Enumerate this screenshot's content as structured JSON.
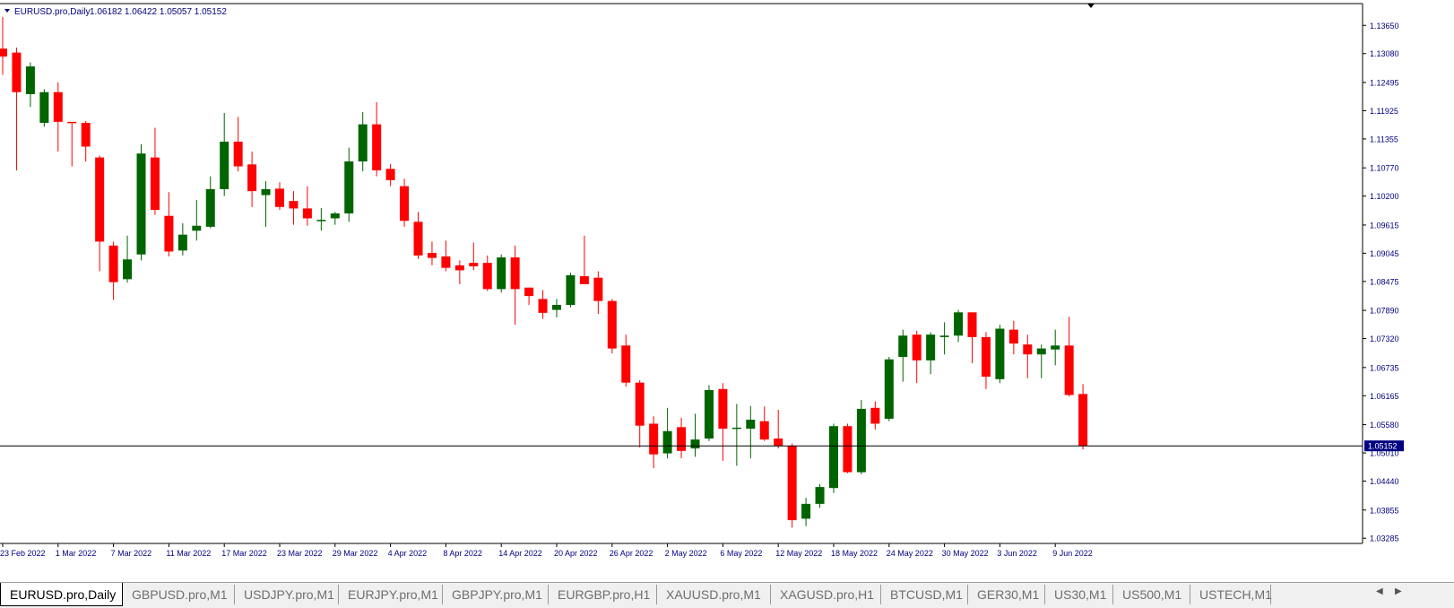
{
  "header": {
    "symbol_label": "EURUSD.pro,Daily",
    "ohlc_label": "1.06182 1.06422 1.05057 1.05152",
    "collapse_icon": "triangle-down-icon"
  },
  "tabs": [
    {
      "label": "EURUSD.pro,Daily",
      "active": true
    },
    {
      "label": "GBPUSD.pro,M1"
    },
    {
      "label": "USDJPY.pro,M1"
    },
    {
      "label": "EURJPY.pro,M1"
    },
    {
      "label": "GBPJPY.pro,M1"
    },
    {
      "label": "EURGBP.pro,H1"
    },
    {
      "label": "XAUUSD.pro,M1"
    },
    {
      "label": "XAGUSD.pro,H1"
    },
    {
      "label": "BTCUSD,M1"
    },
    {
      "label": "GER30,M1"
    },
    {
      "label": "US30,M1"
    },
    {
      "label": "US500,M1"
    },
    {
      "label": "USTECH,M1"
    }
  ],
  "tab_scroll": {
    "left_icon": "arrow-left-icon",
    "right_icon": "arrow-right-icon"
  },
  "chart_data": {
    "type": "candlestick",
    "symbol": "EURUSD.pro",
    "timeframe": "Daily",
    "colors": {
      "up": "#006400",
      "down": "#ff0000",
      "axis": "#000080",
      "price_line": "#000000",
      "price_label_bg": "#000080"
    },
    "y_ticks": [
      1.03285,
      1.03855,
      1.0444,
      1.0501,
      1.0558,
      1.06165,
      1.06735,
      1.0732,
      1.0789,
      1.08475,
      1.09045,
      1.09615,
      1.102,
      1.1077,
      1.11355,
      1.11925,
      1.12495,
      1.1308,
      1.1365
    ],
    "y_tick_labels": [
      "1.03285",
      "1.03855",
      "1.04440",
      "1.05010",
      "1.05580",
      "1.06165",
      "1.06735",
      "1.07320",
      "1.07890",
      "1.08475",
      "1.09045",
      "1.09615",
      "1.10200",
      "1.10770",
      "1.11355",
      "1.11925",
      "1.12495",
      "1.13080",
      "1.13650"
    ],
    "ylim": [
      1.0318,
      1.1409
    ],
    "x_ticks": [
      {
        "label": "23 Feb 2022",
        "index": 0
      },
      {
        "label": "1 Mar 2022",
        "index": 4
      },
      {
        "label": "7 Mar 2022",
        "index": 8
      },
      {
        "label": "11 Mar 2022",
        "index": 12
      },
      {
        "label": "17 Mar 2022",
        "index": 16
      },
      {
        "label": "23 Mar 2022",
        "index": 20
      },
      {
        "label": "29 Mar 2022",
        "index": 24
      },
      {
        "label": "4 Apr 2022",
        "index": 28
      },
      {
        "label": "8 Apr 2022",
        "index": 32
      },
      {
        "label": "14 Apr 2022",
        "index": 36
      },
      {
        "label": "20 Apr 2022",
        "index": 40
      },
      {
        "label": "26 Apr 2022",
        "index": 44
      },
      {
        "label": "2 May 2022",
        "index": 48
      },
      {
        "label": "6 May 2022",
        "index": 52
      },
      {
        "label": "12 May 2022",
        "index": 56
      },
      {
        "label": "18 May 2022",
        "index": 60
      },
      {
        "label": "24 May 2022",
        "index": 64
      },
      {
        "label": "30 May 2022",
        "index": 68
      },
      {
        "label": "3 Jun 2022",
        "index": 72
      },
      {
        "label": "9 Jun 2022",
        "index": 76
      }
    ],
    "current_price": 1.05152,
    "current_price_label": "1.05152",
    "candles": [
      {
        "o": 1.1318,
        "h": 1.1382,
        "l": 1.1265,
        "c": 1.1302
      },
      {
        "o": 1.131,
        "h": 1.132,
        "l": 1.1072,
        "c": 1.123
      },
      {
        "o": 1.1226,
        "h": 1.129,
        "l": 1.12,
        "c": 1.1282
      },
      {
        "o": 1.1168,
        "h": 1.1236,
        "l": 1.116,
        "c": 1.123
      },
      {
        "o": 1.123,
        "h": 1.125,
        "l": 1.111,
        "c": 1.117
      },
      {
        "o": 1.117,
        "h": 1.117,
        "l": 1.108,
        "c": 1.1168
      },
      {
        "o": 1.1168,
        "h": 1.1172,
        "l": 1.109,
        "c": 1.112
      },
      {
        "o": 1.1098,
        "h": 1.1102,
        "l": 1.0868,
        "c": 1.0928
      },
      {
        "o": 1.092,
        "h": 1.0928,
        "l": 1.081,
        "c": 1.0846
      },
      {
        "o": 1.0852,
        "h": 1.094,
        "l": 1.0845,
        "c": 1.0892
      },
      {
        "o": 1.0902,
        "h": 1.1125,
        "l": 1.089,
        "c": 1.1106
      },
      {
        "o": 1.1098,
        "h": 1.1158,
        "l": 1.0982,
        "c": 1.0992
      },
      {
        "o": 1.098,
        "h": 1.1028,
        "l": 1.0898,
        "c": 1.0908
      },
      {
        "o": 1.091,
        "h": 1.0965,
        "l": 1.09,
        "c": 1.0942
      },
      {
        "o": 1.095,
        "h": 1.1012,
        "l": 1.093,
        "c": 1.096
      },
      {
        "o": 1.0958,
        "h": 1.106,
        "l": 1.0955,
        "c": 1.1034
      },
      {
        "o": 1.1034,
        "h": 1.1188,
        "l": 1.102,
        "c": 1.113
      },
      {
        "o": 1.113,
        "h": 1.118,
        "l": 1.107,
        "c": 1.108
      },
      {
        "o": 1.1084,
        "h": 1.111,
        "l": 1.0998,
        "c": 1.103
      },
      {
        "o": 1.1022,
        "h": 1.105,
        "l": 1.0958,
        "c": 1.1034
      },
      {
        "o": 1.1035,
        "h": 1.1048,
        "l": 1.0992,
        "c": 1.0998
      },
      {
        "o": 1.101,
        "h": 1.103,
        "l": 1.0962,
        "c": 1.0995
      },
      {
        "o": 1.0995,
        "h": 1.104,
        "l": 1.096,
        "c": 1.0975
      },
      {
        "o": 1.0972,
        "h": 1.0996,
        "l": 1.095,
        "c": 1.0972
      },
      {
        "o": 1.0975,
        "h": 1.0988,
        "l": 1.0962,
        "c": 1.0985
      },
      {
        "o": 1.0985,
        "h": 1.1118,
        "l": 1.0968,
        "c": 1.109
      },
      {
        "o": 1.109,
        "h": 1.119,
        "l": 1.107,
        "c": 1.1165
      },
      {
        "o": 1.1165,
        "h": 1.121,
        "l": 1.106,
        "c": 1.1072
      },
      {
        "o": 1.1075,
        "h": 1.1085,
        "l": 1.104,
        "c": 1.1052
      },
      {
        "o": 1.104,
        "h": 1.1055,
        "l": 1.0958,
        "c": 1.097
      },
      {
        "o": 1.0968,
        "h": 1.0988,
        "l": 1.0893,
        "c": 1.09
      },
      {
        "o": 1.0905,
        "h": 1.0928,
        "l": 1.088,
        "c": 1.0895
      },
      {
        "o": 1.0898,
        "h": 1.093,
        "l": 1.0868,
        "c": 1.0875
      },
      {
        "o": 1.088,
        "h": 1.089,
        "l": 1.0842,
        "c": 1.087
      },
      {
        "o": 1.0885,
        "h": 1.0926,
        "l": 1.087,
        "c": 1.0878
      },
      {
        "o": 1.0885,
        "h": 1.09,
        "l": 1.0828,
        "c": 1.0832
      },
      {
        "o": 1.0832,
        "h": 1.0902,
        "l": 1.0825,
        "c": 1.0896
      },
      {
        "o": 1.0896,
        "h": 1.092,
        "l": 1.076,
        "c": 1.0832
      },
      {
        "o": 1.0835,
        "h": 1.0835,
        "l": 1.08,
        "c": 1.0818
      },
      {
        "o": 1.0812,
        "h": 1.083,
        "l": 1.0772,
        "c": 1.0784
      },
      {
        "o": 1.079,
        "h": 1.0812,
        "l": 1.0775,
        "c": 1.08
      },
      {
        "o": 1.08,
        "h": 1.0865,
        "l": 1.0795,
        "c": 1.086
      },
      {
        "o": 1.0858,
        "h": 1.094,
        "l": 1.0848,
        "c": 1.0842
      },
      {
        "o": 1.0855,
        "h": 1.0868,
        "l": 1.0782,
        "c": 1.0808
      },
      {
        "o": 1.0808,
        "h": 1.0812,
        "l": 1.0702,
        "c": 1.0712
      },
      {
        "o": 1.0718,
        "h": 1.074,
        "l": 1.0635,
        "c": 1.0643
      },
      {
        "o": 1.0643,
        "h": 1.0648,
        "l": 1.0512,
        "c": 1.0556
      },
      {
        "o": 1.056,
        "h": 1.0575,
        "l": 1.047,
        "c": 1.0498
      },
      {
        "o": 1.05,
        "h": 1.0592,
        "l": 1.049,
        "c": 1.0545
      },
      {
        "o": 1.0553,
        "h": 1.0572,
        "l": 1.049,
        "c": 1.0505
      },
      {
        "o": 1.051,
        "h": 1.058,
        "l": 1.0493,
        "c": 1.0528
      },
      {
        "o": 1.053,
        "h": 1.0638,
        "l": 1.0525,
        "c": 1.0628
      },
      {
        "o": 1.063,
        "h": 1.0642,
        "l": 1.0485,
        "c": 1.055
      },
      {
        "o": 1.055,
        "h": 1.06,
        "l": 1.0475,
        "c": 1.0552
      },
      {
        "o": 1.055,
        "h": 1.0596,
        "l": 1.049,
        "c": 1.0568
      },
      {
        "o": 1.0565,
        "h": 1.0595,
        "l": 1.0525,
        "c": 1.0528
      },
      {
        "o": 1.053,
        "h": 1.0588,
        "l": 1.051,
        "c": 1.0515
      },
      {
        "o": 1.0515,
        "h": 1.052,
        "l": 1.035,
        "c": 1.0365
      },
      {
        "o": 1.0368,
        "h": 1.041,
        "l": 1.0353,
        "c": 1.0398
      },
      {
        "o": 1.0398,
        "h": 1.0438,
        "l": 1.039,
        "c": 1.0432
      },
      {
        "o": 1.043,
        "h": 1.056,
        "l": 1.042,
        "c": 1.0555
      },
      {
        "o": 1.0555,
        "h": 1.056,
        "l": 1.046,
        "c": 1.0462
      },
      {
        "o": 1.0462,
        "h": 1.0608,
        "l": 1.0458,
        "c": 1.059
      },
      {
        "o": 1.0592,
        "h": 1.0605,
        "l": 1.0548,
        "c": 1.056
      },
      {
        "o": 1.057,
        "h": 1.0695,
        "l": 1.0565,
        "c": 1.069
      },
      {
        "o": 1.0695,
        "h": 1.075,
        "l": 1.0645,
        "c": 1.0738
      },
      {
        "o": 1.074,
        "h": 1.0748,
        "l": 1.0642,
        "c": 1.0688
      },
      {
        "o": 1.0688,
        "h": 1.0745,
        "l": 1.066,
        "c": 1.074
      },
      {
        "o": 1.0735,
        "h": 1.0765,
        "l": 1.07,
        "c": 1.0738
      },
      {
        "o": 1.0738,
        "h": 1.079,
        "l": 1.0725,
        "c": 1.0785
      },
      {
        "o": 1.0785,
        "h": 1.0785,
        "l": 1.0682,
        "c": 1.0735
      },
      {
        "o": 1.0735,
        "h": 1.0745,
        "l": 1.063,
        "c": 1.0655
      },
      {
        "o": 1.065,
        "h": 1.076,
        "l": 1.0642,
        "c": 1.0752
      },
      {
        "o": 1.075,
        "h": 1.0768,
        "l": 1.07,
        "c": 1.0722
      },
      {
        "o": 1.072,
        "h": 1.074,
        "l": 1.0652,
        "c": 1.07
      },
      {
        "o": 1.07,
        "h": 1.072,
        "l": 1.0652,
        "c": 1.0712
      },
      {
        "o": 1.071,
        "h": 1.075,
        "l": 1.0678,
        "c": 1.0718
      },
      {
        "o": 1.0718,
        "h": 1.0776,
        "l": 1.0615,
        "c": 1.0618
      },
      {
        "o": 1.062,
        "h": 1.064,
        "l": 1.0508,
        "c": 1.0515
      }
    ]
  }
}
